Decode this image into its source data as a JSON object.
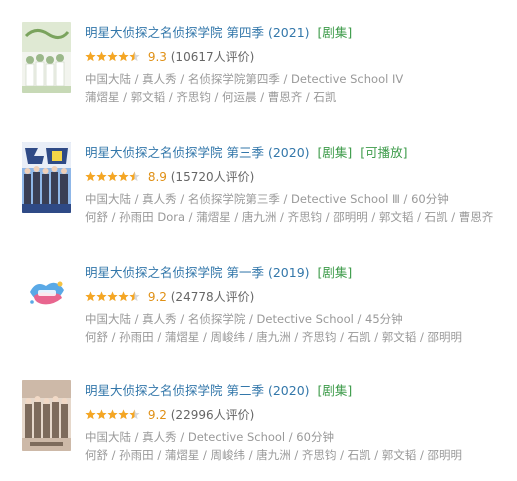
{
  "results": [
    {
      "title": "明星大侦探之名侦探学院 第四季",
      "year": "(2021)",
      "tags": [
        "[剧集]"
      ],
      "rating": "9.3",
      "rating_count": "(10617人评价)",
      "stars": 4.5,
      "meta": "中国大陆 / 真人秀 / 名侦探学院第四季 / Detective School IV",
      "cast": "蒲熠星 / 郭文韬 / 齐思钧 / 何运晨 / 曹恩齐 / 石凯",
      "poster_colors": [
        "#f2f4ee",
        "#7aa35d",
        "#c7d9b6"
      ]
    },
    {
      "title": "明星大侦探之名侦探学院 第三季",
      "year": "(2020)",
      "tags": [
        "[剧集]",
        "[可播放]"
      ],
      "rating": "8.9",
      "rating_count": "(15720人评价)",
      "stars": 4.5,
      "meta": "中国大陆 / 真人秀 / 名侦探学院第三季 / Detective School Ⅲ / 60分钟",
      "cast": "何舒 / 孙雨田 Dora / 蒲熠星 / 唐九洲 / 齐思钧 / 邵明明 / 郭文韬 / 石凯 / 曹恩齐",
      "poster_colors": [
        "#2f4a86",
        "#e9eef7",
        "#8fb7e8"
      ]
    },
    {
      "title": "明星大侦探之名侦探学院 第一季",
      "year": "(2019)",
      "tags": [
        "[剧集]"
      ],
      "rating": "9.2",
      "rating_count": "(24778人评价)",
      "stars": 4.5,
      "meta": "中国大陆 / 真人秀 / 名侦探学院 / Detective School / 45分钟",
      "cast": "何舒 / 孙雨田 / 蒲熠星 / 周峻纬 / 唐九洲 / 齐思钧 / 石凯 / 郭文韬 / 邵明明",
      "poster_colors": [
        "#ffffff",
        "#5aa9e6",
        "#e8668f"
      ]
    },
    {
      "title": "明星大侦探之名侦探学院 第二季",
      "year": "(2020)",
      "tags": [
        "[剧集]"
      ],
      "rating": "9.2",
      "rating_count": "(22996人评价)",
      "stars": 4.5,
      "meta": "中国大陆 / 真人秀 / Detective School / 60分钟",
      "cast": "何舒 / 孙雨田 / 蒲熠星 / 周峻纬 / 唐九洲 / 齐思钧 / 石凯 / 郭文韬 / 邵明明",
      "poster_colors": [
        "#cdb9a8",
        "#7d6b5c",
        "#e6d8cb"
      ]
    }
  ],
  "colors": {
    "title": "#3377aa",
    "tag": "#3d9b4a",
    "star": "#f5a623",
    "star_empty": "#d8d8d8",
    "meta": "#999999"
  }
}
